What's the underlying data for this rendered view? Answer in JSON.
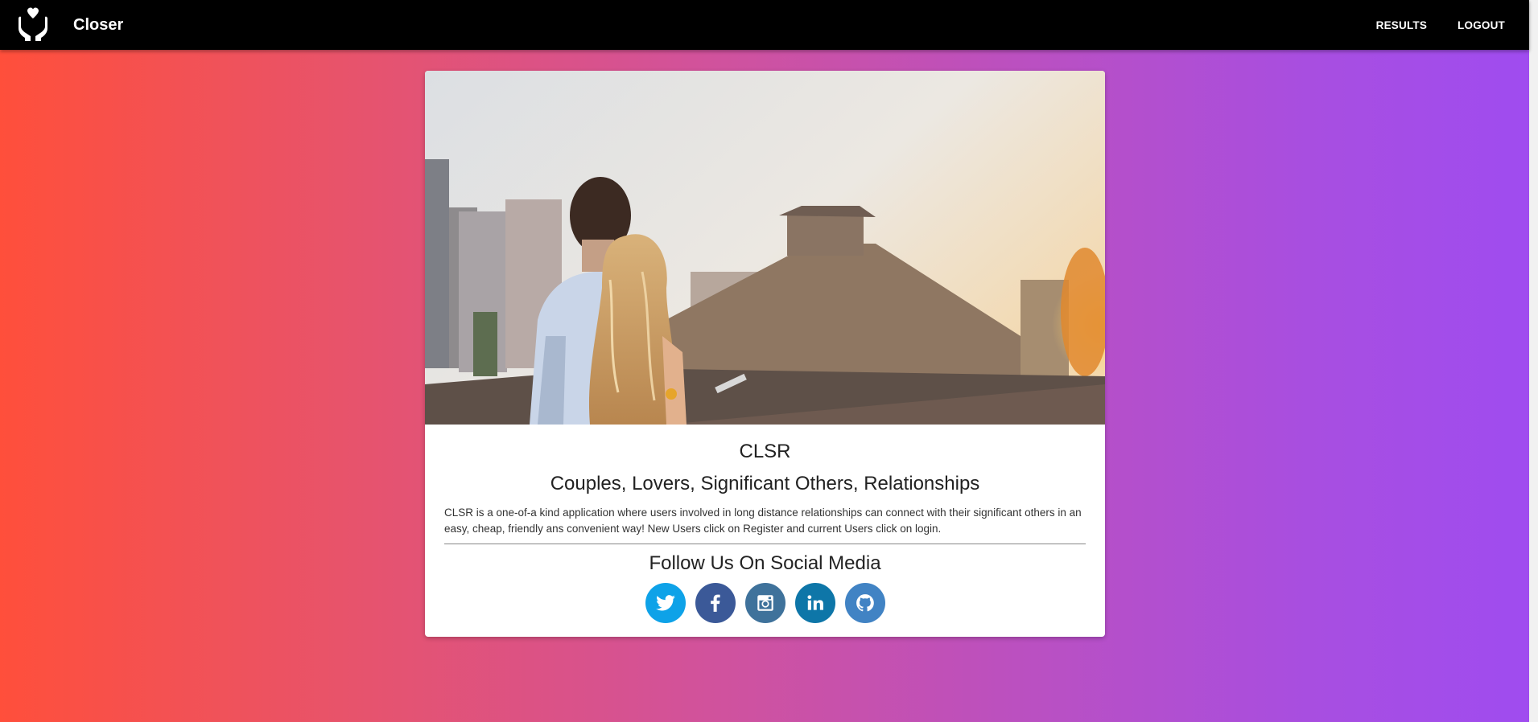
{
  "header": {
    "app_title": "Closer",
    "logo_icon": "heart-hands-icon",
    "nav": [
      {
        "label": "RESULTS"
      },
      {
        "label": "LOGOUT"
      }
    ]
  },
  "card": {
    "image_desc_icon": "couple-photo",
    "title": "CLSR",
    "subtitle": "Couples, Lovers, Significant Others, Relationships",
    "description": "CLSR is a one-of-a kind application where users involved in long distance relationships can connect with their significant others in an easy, cheap, friendly ans convenient way! New Users click on Register and current Users click on login.",
    "follow_heading": "Follow Us On Social Media",
    "socials": [
      {
        "icon": "twitter-icon",
        "color": "#0ea2e8"
      },
      {
        "icon": "facebook-icon",
        "color": "#3b5998"
      },
      {
        "icon": "instagram-icon",
        "color": "#3f729b"
      },
      {
        "icon": "linkedin-icon",
        "color": "#0e76a8"
      },
      {
        "icon": "github-icon",
        "color": "#4183c4"
      }
    ]
  },
  "colors": {
    "gradient_start": "#ff4f3b",
    "gradient_end": "#9f4cf0",
    "topbar": "#000000"
  }
}
